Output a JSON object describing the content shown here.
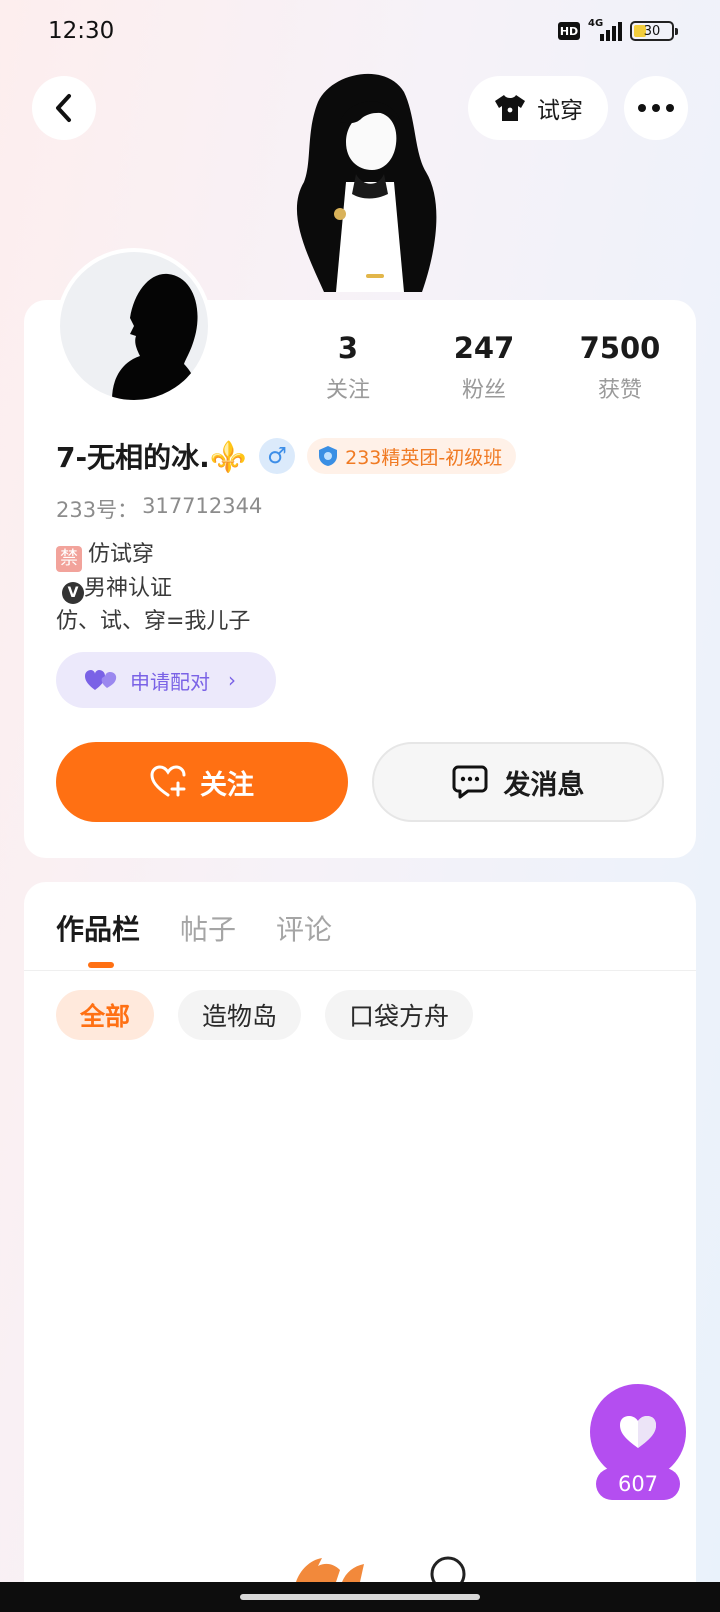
{
  "status_bar": {
    "time": "12:30",
    "hd": "HD",
    "network": "4G",
    "battery_level": "30"
  },
  "nav": {
    "tryon_label": "试穿"
  },
  "profile": {
    "stats": [
      {
        "value": "3",
        "label": "关注"
      },
      {
        "value": "247",
        "label": "粉丝"
      },
      {
        "value": "7500",
        "label": "获赞"
      }
    ],
    "name": "7-无相的冰.",
    "name_emoji": "⚜️",
    "gender": "♂",
    "group_badge": "233精英团-初级班",
    "uid_label": "233号：",
    "uid": "317712344",
    "bio": {
      "ban_tag": "禁",
      "line1": "仿试穿",
      "v_mark": "V",
      "line2": "男神认证",
      "line3": "仿、试、穿=我儿子"
    },
    "pair_label": "申请配对",
    "follow_label": "关注",
    "message_label": "发消息"
  },
  "tabs": [
    {
      "label": "作品栏",
      "active": true
    },
    {
      "label": "帖子",
      "active": false
    },
    {
      "label": "评论",
      "active": false
    }
  ],
  "chips": [
    {
      "label": "全部",
      "active": true
    },
    {
      "label": "造物岛",
      "active": false
    },
    {
      "label": "口袋方舟",
      "active": false
    }
  ],
  "like": {
    "count": "607"
  },
  "colors": {
    "accent": "#ff7013",
    "like_purple": "#b44ef0",
    "pair_purple": "#7a62e6",
    "gender_blue": "#3d8ee8"
  }
}
